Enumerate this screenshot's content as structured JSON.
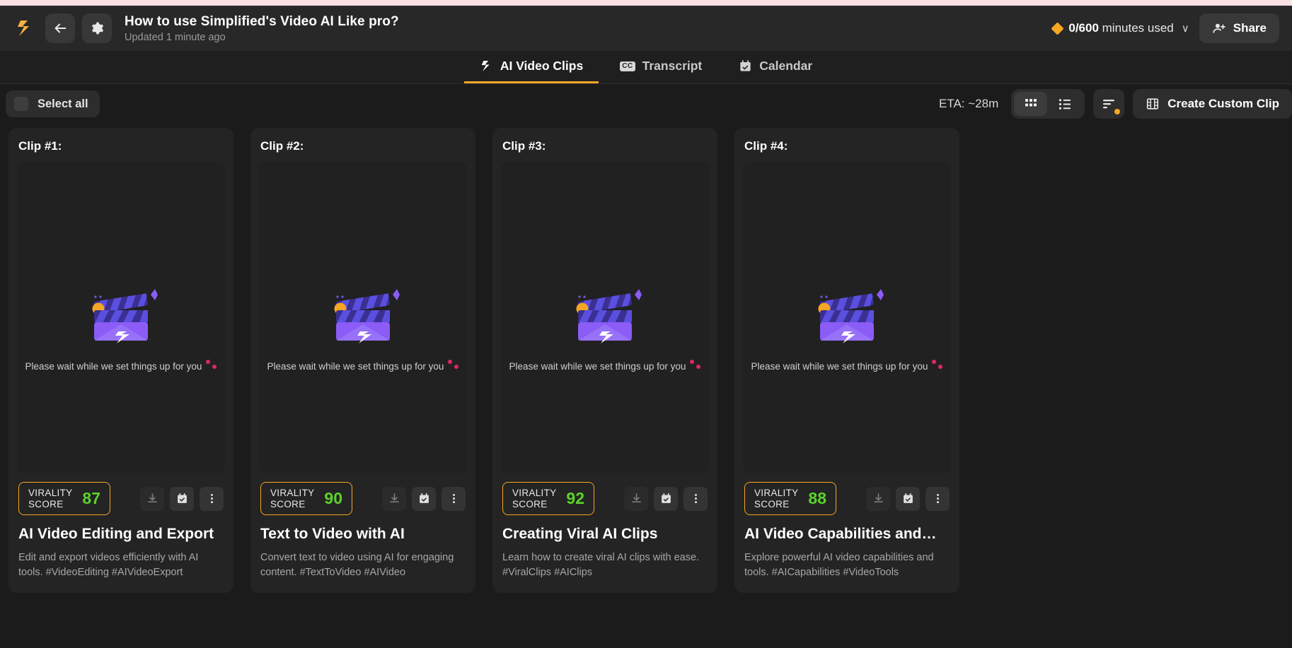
{
  "header": {
    "logo_icon": "simplified-logo-icon",
    "back_icon": "arrow-left-icon",
    "settings_icon": "gear-icon",
    "title": "How to use Simplified's Video AI Like pro?",
    "subtitle": "Updated 1 minute ago",
    "minutes_used": "0/600",
    "minutes_label": "minutes used",
    "minutes_chevron": "∨",
    "share_label": "Share",
    "share_icon": "person-add-icon",
    "accent_color": "#f5a623"
  },
  "tabs": [
    {
      "label": "AI Video Clips",
      "icon": "simplified-s-icon",
      "active": true
    },
    {
      "label": "Transcript",
      "icon": "closed-caption-icon",
      "active": false,
      "cc_text": "CC"
    },
    {
      "label": "Calendar",
      "icon": "calendar-check-icon",
      "active": false
    }
  ],
  "toolbar": {
    "select_all_label": "Select all",
    "eta_label": "ETA: ~28m",
    "grid_view_icon": "grid-view-icon",
    "list_view_icon": "list-view-icon",
    "filter_icon": "filter-sort-icon",
    "create_custom_clip_label": "Create Custom Clip",
    "create_icon": "film-strip-icon"
  },
  "clips": [
    {
      "header": "Clip #1:",
      "placeholder_text": "Please wait while we set things up for you",
      "virality_label_line1": "VIRALITY",
      "virality_label_line2": "SCORE",
      "virality_score": "87",
      "title": "AI Video Editing and Export",
      "description": "Edit and export videos efficiently with AI tools. #VideoEditing #AIVideoExport",
      "download_icon": "download-icon",
      "schedule_icon": "calendar-check-icon",
      "more_icon": "more-vertical-icon"
    },
    {
      "header": "Clip #2:",
      "placeholder_text": "Please wait while we set things up for you",
      "virality_label_line1": "VIRALITY",
      "virality_label_line2": "SCORE",
      "virality_score": "90",
      "title": "Text to Video with AI",
      "description": "Convert text to video using AI for engaging content. #TextToVideo #AIVideo",
      "download_icon": "download-icon",
      "schedule_icon": "calendar-check-icon",
      "more_icon": "more-vertical-icon"
    },
    {
      "header": "Clip #3:",
      "placeholder_text": "Please wait while we set things up for you",
      "virality_label_line1": "VIRALITY",
      "virality_label_line2": "SCORE",
      "virality_score": "92",
      "title": "Creating Viral AI Clips",
      "description": "Learn how to create viral AI clips with ease. #ViralClips #AIClips",
      "download_icon": "download-icon",
      "schedule_icon": "calendar-check-icon",
      "more_icon": "more-vertical-icon"
    },
    {
      "header": "Clip #4:",
      "placeholder_text": "Please wait while we set things up for you",
      "virality_label_line1": "VIRALITY",
      "virality_label_line2": "SCORE",
      "virality_score": "88",
      "title": "AI Video Capabilities and…",
      "description": "Explore powerful AI video capabilities and tools. #AICapabilities #VideoTools",
      "download_icon": "download-icon",
      "schedule_icon": "calendar-check-icon",
      "more_icon": "more-vertical-icon"
    }
  ]
}
